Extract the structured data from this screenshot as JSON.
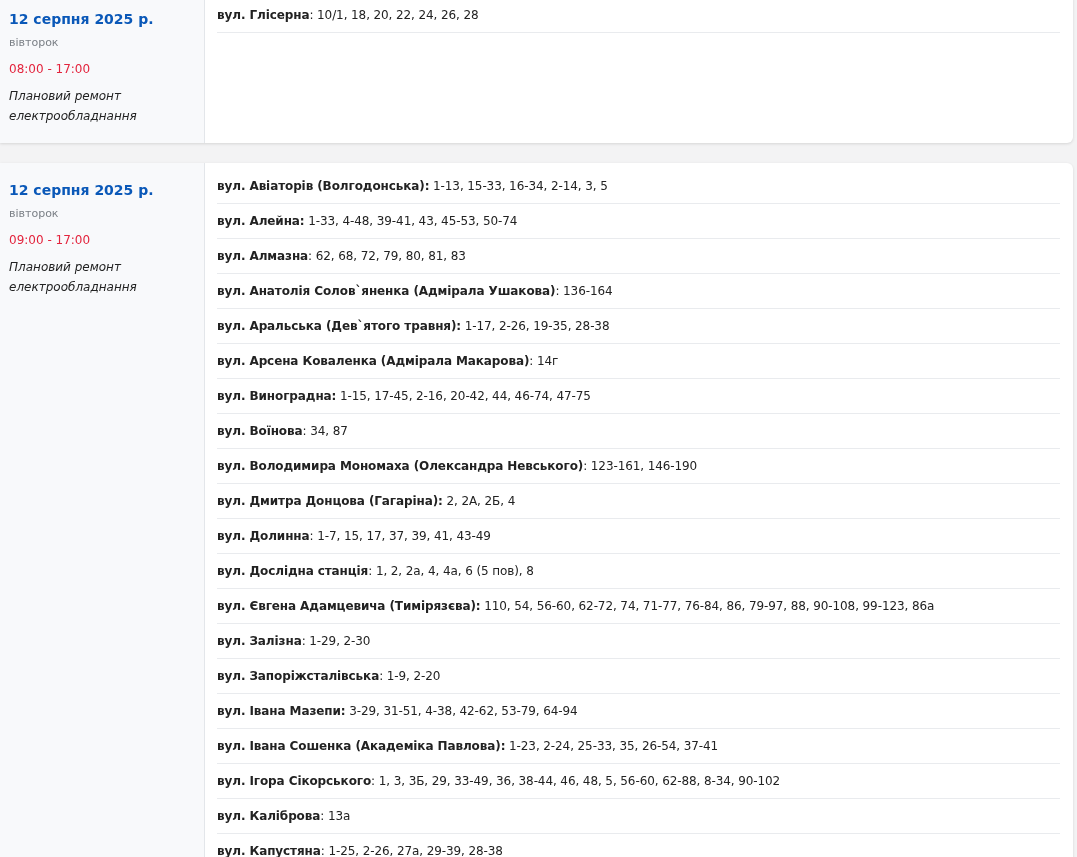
{
  "outages": [
    {
      "date": "12 серпня 2025 р.",
      "weekday": "вівторок",
      "time": "08:00 - 17:00",
      "reason": "Плановий ремонт електрообладнання",
      "addresses": [
        "**вул. Глісерна**: 10/1, 18, 20, 22, 24, 26, 28"
      ]
    },
    {
      "date": "12 серпня 2025 р.",
      "weekday": "вівторок",
      "time": "09:00 - 17:00",
      "reason": "Плановий ремонт електрообладнання",
      "addresses": [
        "**вул. Авіаторів (Волгодонська):** 1-13, 15-33, 16-34, 2-14, 3, 5",
        "**вул. Алейна:** 1-33, 4-48, 39-41, 43, 45-53, 50-74",
        "**вул. Алмазна**: 62, 68, 72, 79, 80, 81, 83",
        "**вул. Анатолія Солов`яненка (Адмірала Ушакова)**: 136-164",
        "**вул. Аральська (Дев`ятого травня):** 1-17, 2-26, 19-35, 28-38",
        "**вул. Арсена Коваленка (Адмірала Макарова)**: 14г",
        "**вул. Виноградна:** 1-15, 17-45, 2-16, 20-42, 44, 46-74, 47-75",
        "**вул. Воїнова**: 34, 87",
        "**вул. Володимира Мономаха (Олександра Невського)**: 123-161, 146-190",
        "**вул. Дмитра Донцова (Гагаріна):** 2, 2А, 2Б, 4",
        "**вул. Долинна**: 1-7, 15, 17, 37, 39, 41, 43-49",
        "**вул. Дослідна станція**: 1, 2, 2а, 4, 4а, 6 (5 пов), 8",
        "**вул. Євгена Адамцевича (Тимірязєва):** 110, 54, 56-60, 62-72, 74, 71-77, 76-84, 86, 79-97, 88, 90-108, 99-123, 86а",
        "**вул. Залізна**: 1-29, 2-30",
        "**вул. Запоріжсталівська**: 1-9, 2-20",
        "**вул. Івана Мазепи:** 3-29, 31-51, 4-38, 42-62, 53-79, 64-94",
        "**вул. Івана Сошенка (Академіка Павлова):** 1-23, 2-24, 25-33, 35, 26-54, 37-41",
        "**вул. Ігора Сікорського**: 1, 3, 3Б, 29, 33-49, 36, 38-44, 46, 48, 5, 56-60, 62-88, 8-34, 90-102",
        "**вул. Каліброва**: 13а",
        "**вул. Капустяна**: 1-25, 2-26, 27а, 29-39, 28-38"
      ]
    }
  ]
}
